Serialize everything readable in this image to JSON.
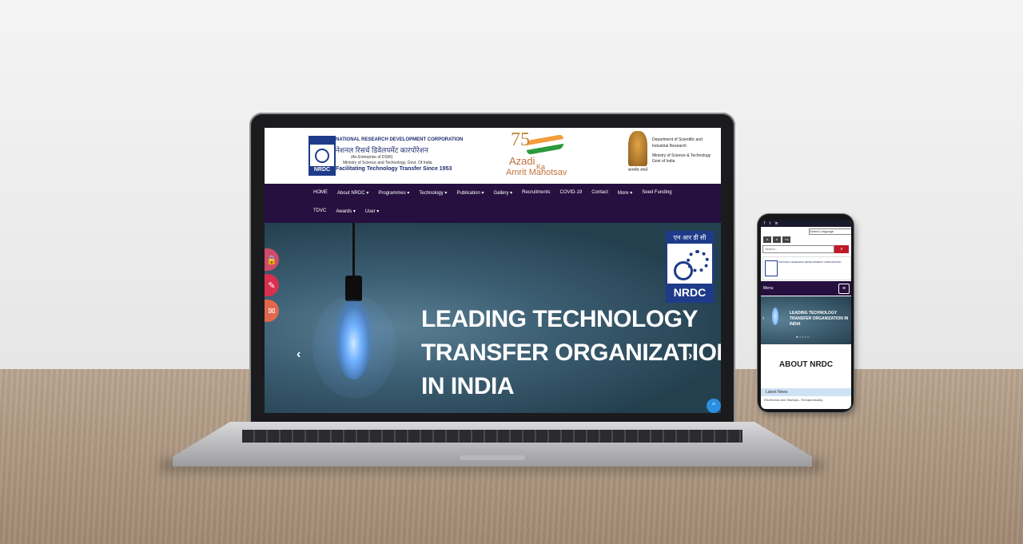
{
  "header": {
    "org_name": "NATIONAL RESEARCH DEVELOPMENT CORPORATION",
    "org_hindi": "नेशनल रिसर्च डिवेलपमेंट कारपोरेशन",
    "enterprise": "(An Enterprise of DSIR)",
    "ministry": "Ministry of Science and Technology, Govt. Of India",
    "tagline": "Facilitating Technology Transfer Since 1953",
    "logo_text": "NRDC",
    "azadi_75": "75",
    "azadi_line1": "Azadi",
    "azadi_ka": "Ka",
    "azadi_line2": "Amrit Mahotsav",
    "emblem_caption": "सत्यमेव जयते",
    "dept_line1": "Department of Scientific and",
    "dept_line2": "Industrial Research",
    "dept_line3": "Ministry of Science & Technology",
    "dept_line4": "Govt of India"
  },
  "nav": {
    "row1": [
      "HOME",
      "About NRDC ▾",
      "Programmes ▾",
      "Technology ▾",
      "Publication ▾",
      "Gallery ▾",
      "Recruitments",
      "COVID-19",
      "Contact",
      "More ▾",
      "Seed Funding"
    ],
    "row2": [
      "TDVC",
      "Awards ▾",
      "User ▾"
    ]
  },
  "hero": {
    "line1": "LEADING TECHNOLOGY",
    "line2": "TRANSFER ORGANIZATION",
    "line3": "IN INDIA",
    "logo_hindi": "एन आर डी सी",
    "logo_text": "NRDC",
    "prev": "‹",
    "next": "›",
    "scroll_top": "^"
  },
  "phone": {
    "social": [
      "f",
      "t",
      "in"
    ],
    "language": "Select Language",
    "font_buttons": [
      "A",
      "A",
      "+A"
    ],
    "search_placeholder": "Search...",
    "menu_label": "Menu",
    "burger": "≡",
    "hero_text": "LEADING TECHNOLOGY TRANSFER ORGANIZATION IN INDIA",
    "slider_dots": "● ○ ○ ○ ○",
    "about": "ABOUT NRDC",
    "news": "Latest News",
    "news_item": "Electronics and Startups- Therapeutically-"
  },
  "colors": {
    "nav_bg": "#25103f",
    "brand_blue": "#1e3b8a",
    "hero_bg": "#3c5e72",
    "search_button": "#c01a2a"
  }
}
